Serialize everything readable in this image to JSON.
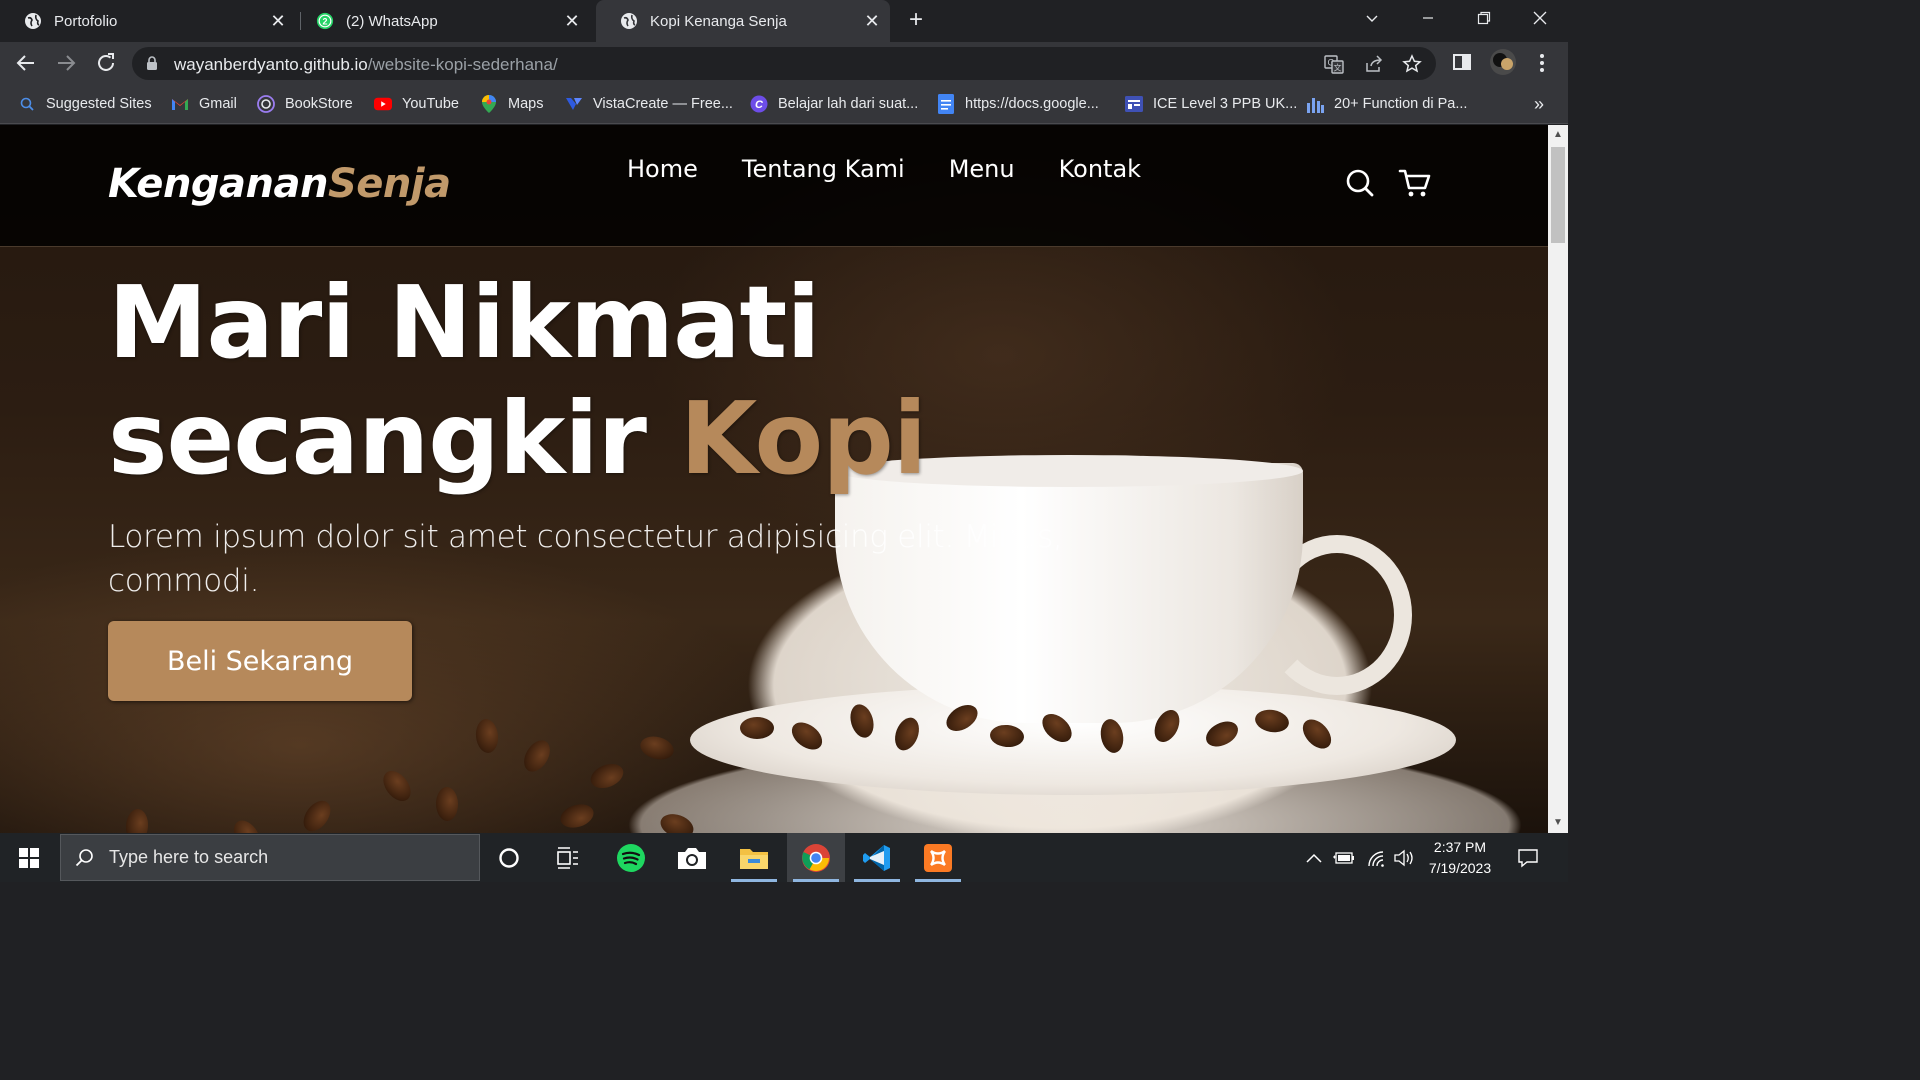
{
  "browser": {
    "tabs": [
      {
        "title": "Portofolio",
        "icon": "globe-icon",
        "active": false
      },
      {
        "title": "(2) WhatsApp",
        "icon": "whatsapp-icon",
        "badge": "2",
        "active": false
      },
      {
        "title": "Kopi Kenanga Senja",
        "icon": "globe-icon",
        "active": true
      }
    ],
    "url_host": "wayanberdyanto.github.io",
    "url_path": "/website-kopi-sederhana/",
    "bookmarks": [
      {
        "label": "Suggested Sites",
        "icon": "search-icon"
      },
      {
        "label": "Gmail",
        "icon": "gmail-icon"
      },
      {
        "label": "BookStore",
        "icon": "bookstore-icon"
      },
      {
        "label": "YouTube",
        "icon": "youtube-icon"
      },
      {
        "label": "Maps",
        "icon": "maps-icon"
      },
      {
        "label": "VistaCreate — Free...",
        "icon": "vistacreate-icon"
      },
      {
        "label": "Belajar lah dari suat...",
        "icon": "canva-icon"
      },
      {
        "label": "https://docs.google...",
        "icon": "docs-icon"
      },
      {
        "label": "ICE Level 3 PPB UK...",
        "icon": "forms-icon"
      },
      {
        "label": "20+ Function di Pa...",
        "icon": "bar-chart-icon"
      }
    ],
    "more_bookmarks": "»"
  },
  "site": {
    "logo_main": "Kenganan",
    "logo_accent": "Senja",
    "nav": [
      "Home",
      "Tentang Kami",
      "Menu",
      "Kontak"
    ],
    "hero_title_line1": "Mari Nikmati",
    "hero_title_line2": "secangkir",
    "hero_title_accent": "Kopi",
    "hero_text": "Lorem ipsum dolor sit amet consectetur adipisicing elit. Minus, commodi.",
    "cta_label": "Beli Sekarang"
  },
  "taskbar": {
    "search_placeholder": "Type here to search",
    "time": "2:37 PM",
    "date": "7/19/2023"
  },
  "colors": {
    "accent": "#b6895b",
    "chrome_dark": "#202124",
    "chrome_toolbar": "#35363a"
  }
}
